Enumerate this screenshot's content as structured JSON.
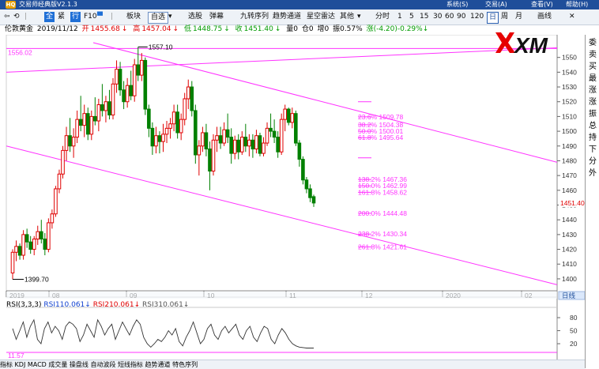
{
  "titlebar": {
    "app_title": "交易师经典版V2.1.3",
    "logo_text": "HQ",
    "menu": [
      "系统(S)",
      "交易(A)",
      "查看(V)",
      "帮助(H)"
    ]
  },
  "toolbar": {
    "items": [
      "全",
      "紧",
      "行",
      "F10",
      "板块",
      "自选",
      "选股",
      "弹幕",
      "九转序列",
      "趋势通道",
      "星空雷达",
      "其他",
      "分时",
      "1",
      "5",
      "15",
      "30",
      "60",
      "90",
      "120",
      "日",
      "周",
      "月",
      "画线"
    ],
    "selected": "日"
  },
  "quote": {
    "symbol": "伦敦黄金",
    "date": "2019/11/12",
    "open_label": "开",
    "open": "1455.68",
    "open_arrow": "↓",
    "high_label": "高",
    "high": "1457.04",
    "high_arrow": "↓",
    "low_label": "低",
    "low": "1448.75",
    "low_arrow": "↓",
    "close_label": "收",
    "close": "1451.40",
    "close_arrow": "↓",
    "volume": "量0",
    "position": "仓0",
    "position_change": "增0",
    "amplitude": "振0.57%",
    "change": "涨(-4.20)-0.29%↓"
  },
  "right_panel": {
    "chars": [
      "委",
      "卖",
      "买",
      "最",
      "涨",
      "涨",
      "振",
      "总",
      "持",
      "下",
      "分",
      "外"
    ]
  },
  "brand": {
    "logo": "XM"
  },
  "chart_data": {
    "type": "candlestick",
    "price_axis": {
      "min": 1393,
      "max": 1560,
      "ticks": [
        1550,
        1540,
        1530,
        1520,
        1510,
        1500,
        1490,
        1480,
        1470,
        1460,
        1450,
        1440,
        1430,
        1420,
        1410,
        1400
      ]
    },
    "time_axis_labels": [
      "2019",
      "08",
      "09",
      "10",
      "11",
      "12",
      "2020",
      "02"
    ],
    "last_price": "1451.40",
    "high_label": "1557.10",
    "low_label": "1399.70",
    "upper_line_label": "1556.02",
    "fib_upper": [
      {
        "label": "23.6%",
        "value": "1509.78"
      },
      {
        "label": "38.2%",
        "value": "1504.38"
      },
      {
        "label": "50.0%",
        "value": "1500.01"
      },
      {
        "label": "61.8%",
        "value": "1495.64"
      }
    ],
    "fib_lower": [
      {
        "label": "138.2%",
        "value": "1467.36"
      },
      {
        "label": "150.0%",
        "value": "1462.99"
      },
      {
        "label": "161.8%",
        "value": "1458.62"
      },
      {
        "label": "200.0%",
        "value": "1444.48"
      },
      {
        "label": "238.2%",
        "value": "1430.34"
      },
      {
        "label": "261.8%",
        "value": "1421.61"
      }
    ],
    "fib_level_values": [
      1509.78,
      1504.38,
      1500.01,
      1495.64,
      1467.36,
      1462.99,
      1458.62,
      1444.48,
      1430.34,
      1421.61
    ],
    "candles": [
      [
        1404,
        1420,
        1399.7,
        1418
      ],
      [
        1418,
        1426,
        1412,
        1422
      ],
      [
        1422,
        1424,
        1413,
        1416
      ],
      [
        1416,
        1433,
        1413,
        1430
      ],
      [
        1430,
        1434,
        1421,
        1425
      ],
      [
        1425,
        1429,
        1417,
        1420
      ],
      [
        1420,
        1429,
        1416,
        1427
      ],
      [
        1427,
        1436,
        1423,
        1432
      ],
      [
        1432,
        1440,
        1424,
        1427
      ],
      [
        1427,
        1431,
        1416,
        1420
      ],
      [
        1420,
        1441,
        1418,
        1438
      ],
      [
        1438,
        1447,
        1434,
        1444
      ],
      [
        1444,
        1463,
        1442,
        1461
      ],
      [
        1461,
        1474,
        1458,
        1471
      ],
      [
        1471,
        1490,
        1468,
        1487
      ],
      [
        1487,
        1503,
        1480,
        1497
      ],
      [
        1497,
        1509,
        1486,
        1490
      ],
      [
        1490,
        1502,
        1482,
        1496
      ],
      [
        1496,
        1514,
        1492,
        1508
      ],
      [
        1508,
        1524,
        1500,
        1504
      ],
      [
        1504,
        1518,
        1496,
        1512
      ],
      [
        1512,
        1516,
        1494,
        1498
      ],
      [
        1498,
        1514,
        1494,
        1510
      ],
      [
        1510,
        1523,
        1504,
        1507
      ],
      [
        1507,
        1522,
        1500,
        1518
      ],
      [
        1518,
        1532,
        1510,
        1514
      ],
      [
        1514,
        1524,
        1506,
        1520
      ],
      [
        1520,
        1528,
        1508,
        1511
      ],
      [
        1511,
        1536,
        1508,
        1532
      ],
      [
        1532,
        1548,
        1526,
        1542
      ],
      [
        1542,
        1547,
        1524,
        1528
      ],
      [
        1528,
        1534,
        1515,
        1520
      ],
      [
        1520,
        1536,
        1516,
        1531
      ],
      [
        1531,
        1541,
        1521,
        1524
      ],
      [
        1524,
        1549,
        1520,
        1545
      ],
      [
        1545,
        1557.1,
        1534,
        1538
      ],
      [
        1538,
        1553,
        1534,
        1548
      ],
      [
        1548,
        1550,
        1511,
        1515
      ],
      [
        1515,
        1518,
        1496,
        1502
      ],
      [
        1502,
        1506,
        1484,
        1490
      ],
      [
        1490,
        1503,
        1485,
        1497
      ],
      [
        1497,
        1500,
        1485,
        1493
      ],
      [
        1493,
        1505,
        1486,
        1498
      ],
      [
        1498,
        1507,
        1492,
        1502
      ],
      [
        1502,
        1509,
        1495,
        1505
      ],
      [
        1505,
        1518,
        1500,
        1513
      ],
      [
        1513,
        1518,
        1495,
        1499
      ],
      [
        1499,
        1512,
        1494,
        1508
      ],
      [
        1508,
        1526,
        1504,
        1522
      ],
      [
        1522,
        1535,
        1515,
        1530
      ],
      [
        1530,
        1534,
        1510,
        1514
      ],
      [
        1514,
        1518,
        1478,
        1484
      ],
      [
        1484,
        1494,
        1470,
        1490
      ],
      [
        1490,
        1503,
        1486,
        1499
      ],
      [
        1499,
        1505,
        1483,
        1488
      ],
      [
        1488,
        1493,
        1460,
        1473
      ],
      [
        1473,
        1498,
        1470,
        1494
      ],
      [
        1494,
        1503,
        1486,
        1497
      ],
      [
        1497,
        1503,
        1488,
        1492
      ],
      [
        1492,
        1506,
        1490,
        1501
      ],
      [
        1501,
        1512,
        1492,
        1496
      ],
      [
        1496,
        1502,
        1478,
        1485
      ],
      [
        1485,
        1497,
        1481,
        1494
      ],
      [
        1494,
        1498,
        1481,
        1486
      ],
      [
        1486,
        1500,
        1484,
        1496
      ],
      [
        1496,
        1505,
        1486,
        1490
      ],
      [
        1490,
        1498,
        1483,
        1494
      ],
      [
        1494,
        1498,
        1482,
        1488
      ],
      [
        1488,
        1501,
        1485,
        1497
      ],
      [
        1497,
        1499,
        1483,
        1485
      ],
      [
        1485,
        1496,
        1483,
        1492
      ],
      [
        1492,
        1506,
        1490,
        1502
      ],
      [
        1502,
        1512,
        1496,
        1500
      ],
      [
        1500,
        1508,
        1492,
        1496
      ],
      [
        1496,
        1500,
        1482,
        1486
      ],
      [
        1486,
        1512,
        1484,
        1508
      ],
      [
        1508,
        1518,
        1500,
        1515
      ],
      [
        1515,
        1516,
        1504,
        1506
      ],
      [
        1506,
        1516,
        1502,
        1512
      ],
      [
        1512,
        1514,
        1490,
        1492
      ],
      [
        1492,
        1494,
        1476,
        1481
      ],
      [
        1481,
        1483,
        1464,
        1467
      ],
      [
        1467,
        1469,
        1458,
        1461
      ],
      [
        1461,
        1464,
        1452,
        1455
      ],
      [
        1455.68,
        1457.04,
        1448.75,
        1451.4
      ]
    ]
  },
  "rsi": {
    "title": "RSI(3,3,3)",
    "rsi1_label": "RSI1",
    "rsi1": "10.061",
    "rsi2_label": "RSI2",
    "rsi2": "10.061",
    "rsi3_label": "RSI3",
    "rsi3": "10.061",
    "ticks": [
      80,
      50,
      20
    ],
    "bottom_value": "11.57",
    "values": [
      55,
      30,
      50,
      70,
      35,
      60,
      75,
      30,
      20,
      55,
      70,
      45,
      60,
      50,
      30,
      60,
      70,
      65,
      55,
      25,
      40,
      65,
      50,
      35,
      75,
      60,
      40,
      55,
      65,
      30,
      50,
      70,
      55,
      40,
      60,
      75,
      65,
      35,
      20,
      12,
      20,
      30,
      25,
      35,
      50,
      40,
      55,
      25,
      15,
      35,
      50,
      70,
      45,
      20,
      30,
      55,
      65,
      40,
      30,
      50,
      60,
      45,
      55,
      65,
      40,
      30,
      50,
      60,
      35,
      25,
      45,
      60,
      55,
      30,
      20,
      40,
      55,
      45,
      30,
      20,
      15,
      12,
      11,
      10,
      10,
      10
    ]
  },
  "bottom_tabs": "指标 KDJ MACD 成交量 操盘线 自动波段 短线指标 趋势通道 特色序列"
}
